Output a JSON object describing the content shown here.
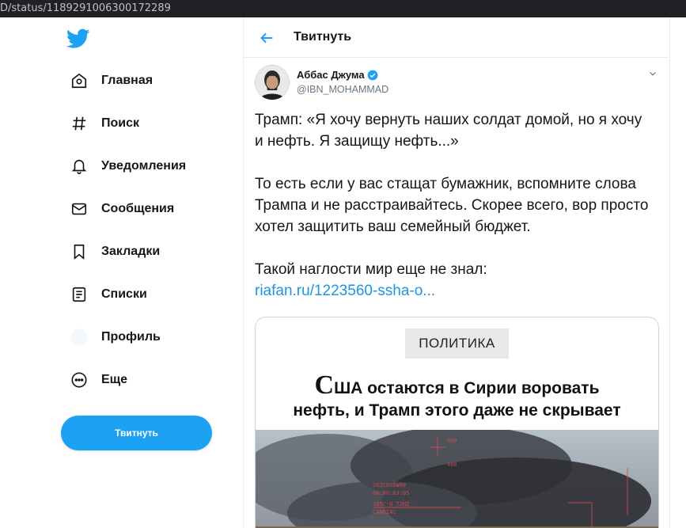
{
  "browser": {
    "url": "D/status/1189291006300172289"
  },
  "sidebar": {
    "items": [
      {
        "label": "Главная",
        "icon": "home-icon"
      },
      {
        "label": "Поиск",
        "icon": "hashtag-icon"
      },
      {
        "label": "Уведомления",
        "icon": "bell-icon"
      },
      {
        "label": "Сообщения",
        "icon": "envelope-icon"
      },
      {
        "label": "Закладки",
        "icon": "bookmark-icon"
      },
      {
        "label": "Списки",
        "icon": "list-icon"
      },
      {
        "label": "Профиль",
        "icon": "profile-icon"
      },
      {
        "label": "Еще",
        "icon": "more-icon"
      }
    ],
    "tweet_button": "Твитнуть"
  },
  "header": {
    "title": "Твитнуть"
  },
  "tweet": {
    "author_name": "Аббас Джума",
    "author_handle": "@IBN_MOHAMMAD",
    "paragraphs": [
      "Трамп: «Я хочу вернуть наших солдат домой, но я хочу и нефть. Я защищу нефть...»",
      "То есть если у вас стащат бумажник, вспомните слова Трампа и не расстраивайтесь. Скорее всего, вор просто хотел защитить ваш семейный бюджет.",
      "Такой наглости мир еще не знал:"
    ],
    "link": "riafan.ru/1223560-ssha-o..."
  },
  "card": {
    "badge": "ПОЛИТИКА",
    "headline_cap": "С",
    "headline_line1": "ША остаются в Сирии воровать",
    "headline_line2": "нефть, и Трамп этого даже не скрывает"
  },
  "colors": {
    "accent": "#1da1f2",
    "link": "#1b95e0",
    "text": "#14171a",
    "muted": "#657786"
  }
}
